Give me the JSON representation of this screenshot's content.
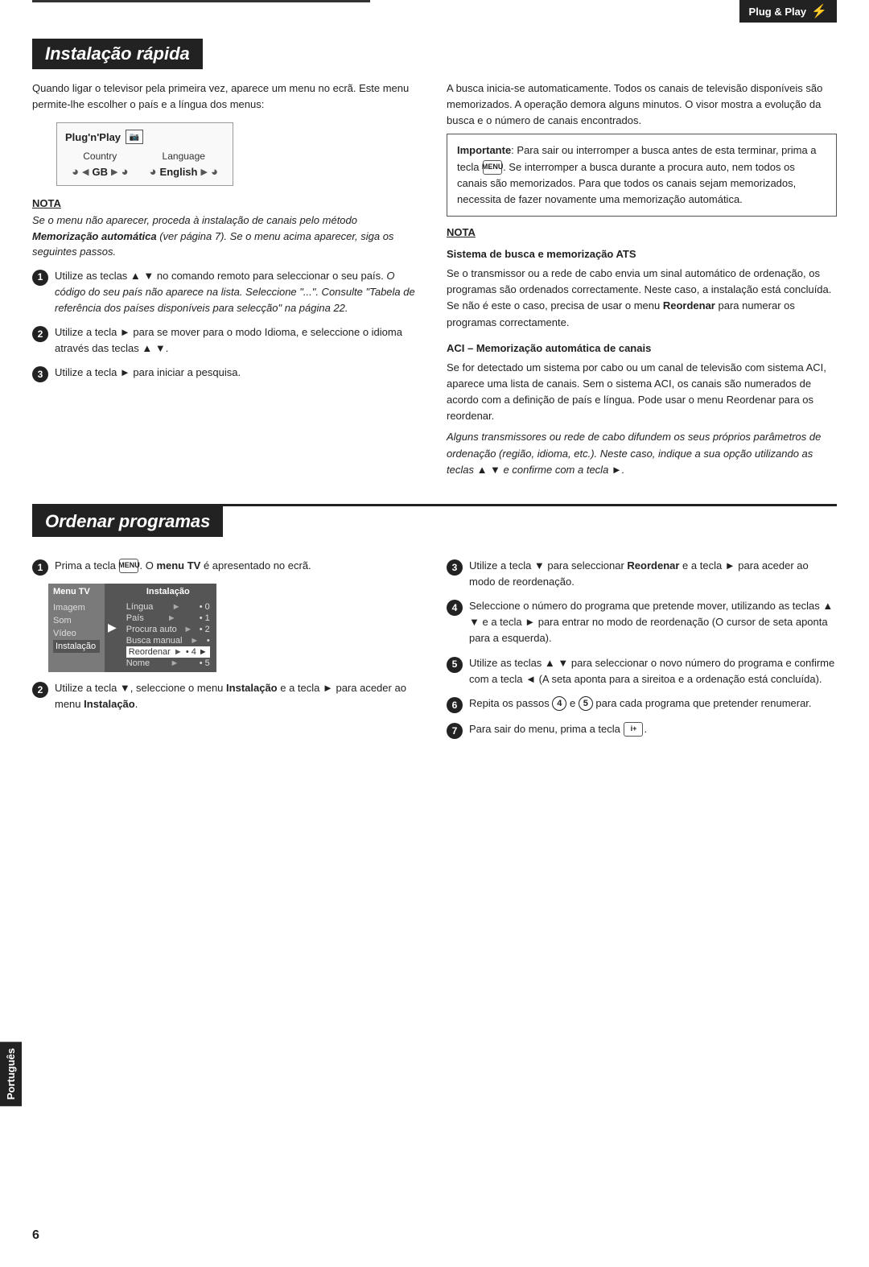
{
  "page": {
    "number": "6",
    "portugues_label": "Português"
  },
  "plug_play": {
    "badge_text": "Plug & Play",
    "plug_symbol": "⚡"
  },
  "section1": {
    "heading": "Instalação rápida",
    "left_intro": "Quando ligar o televisor pela primeira vez, aparece um menu no ecrã. Este menu permite-lhe escolher o país e a língua dos menus:",
    "pnp_menu": {
      "title": "Plug'n'Play",
      "country_label": "Country",
      "language_label": "Language",
      "country_value": "GB",
      "language_value": "English"
    },
    "nota1": {
      "title": "NOTA",
      "text": "Se o menu não aparecer, proceda à instalação de canais pelo método Memorização automática (ver página 7). Se o menu acima aparecer, siga os seguintes passos."
    },
    "steps_left": [
      {
        "num": "1",
        "text": "Utilize as teclas ▲ ▼ no comando remoto para seleccionar o seu país. O código do seu país não aparece na lista. Seleccione \"...\". Consulte \"Tabela de referência dos países disponíveis para selecção\" na página 22."
      },
      {
        "num": "2",
        "text": "Utilize a tecla ► para se mover para o modo Idioma, e seleccione o idioma através das teclas ▲ ▼."
      },
      {
        "num": "3",
        "text": "Utilize a tecla ► para iniciar a pesquisa."
      }
    ],
    "right_para1": "A busca inicia-se automaticamente. Todos os canais de televisão disponíveis são memorizados. A operação demora alguns minutos. O visor mostra a evolução da busca e o número de canais encontrados.",
    "important_box": {
      "title": "Importante",
      "text": ": Para sair ou interromper a busca antes de esta terminar, prima a tecla MENU. Se interromper a busca durante a procura auto, nem todos os canais são memorizados. Para que todos os canais sejam memorizados, necessita de fazer novamente uma memorização automática."
    },
    "nota2": {
      "title": "NOTA",
      "subtitle": "Sistema de busca e memorização ATS",
      "text": "Se o transmissor ou a rede de cabo envia um sinal automático de ordenação, os programas são ordenados correctamente. Neste caso, a instalação está concluída. Se não é este o caso, precisa de usar o menu Reordenar para numerar os programas correctamente."
    },
    "aci": {
      "title": "ACI – Memorização automática de canais",
      "text": "Se for detectado um sistema por cabo ou um canal de televisão com sistema ACI, aparece uma lista de canais. Sem o sistema ACI, os canais são numerados de acordo com a definição de país e língua. Pode usar o menu Reordenar para os reordenar.",
      "italic_text": "Alguns transmissores ou rede de cabo difundem os seus próprios parâmetros de ordenação (região, idioma, etc.). Neste caso, indique a sua opção utilizando as teclas ▲ ▼ e confirme com a tecla ►."
    }
  },
  "section2": {
    "heading": "Ordenar programas",
    "step1": {
      "num": "1",
      "text": "Prima a tecla MENU. O menu TV é apresentado no ecrã."
    },
    "menu_tv": {
      "left_title": "Menu TV",
      "items_left": [
        "Imagem",
        "Som",
        "Vídeo",
        "Instalação"
      ],
      "right_title": "Instalação",
      "items_right": [
        {
          "label": "Língua",
          "dot": "•",
          "num": "0"
        },
        {
          "label": "País",
          "dot": "•",
          "num": "1"
        },
        {
          "label": "Procura auto",
          "dot": "•",
          "num": "2"
        },
        {
          "label": "Busca manual",
          "dot": "•",
          "num": ""
        },
        {
          "label": "Reordenar",
          "dot": "•",
          "num": "4",
          "highlight": true
        },
        {
          "label": "Nome",
          "dot": "•",
          "num": "5"
        }
      ]
    },
    "step2": {
      "num": "2",
      "text": "Utilize a tecla ▼, seleccione o menu Instalação e a tecla ► para aceder ao menu Instalação."
    },
    "step3": {
      "num": "3",
      "text": "Utilize a tecla ▼ para seleccionar Reordenar e a tecla ► para aceder ao modo de reordenação."
    },
    "step4": {
      "num": "4",
      "text": "Seleccione o número do programa que pretende mover, utilizando as teclas ▲ ▼ e a tecla ► para entrar no modo de reordenação (O cursor de seta aponta para a esquerda)."
    },
    "step5": {
      "num": "5",
      "text": "Utilize as teclas ▲ ▼ para seleccionar o novo número do programa e confirme com a tecla ◄ (A seta aponta para a sireitoa e a ordenação está concluída)."
    },
    "step6": {
      "num": "6",
      "text": "Repita os passos 4 e 5 para cada programa que pretender renumerar."
    },
    "step7": {
      "num": "7",
      "text": "Para sair do menu, prima a tecla i+."
    }
  }
}
